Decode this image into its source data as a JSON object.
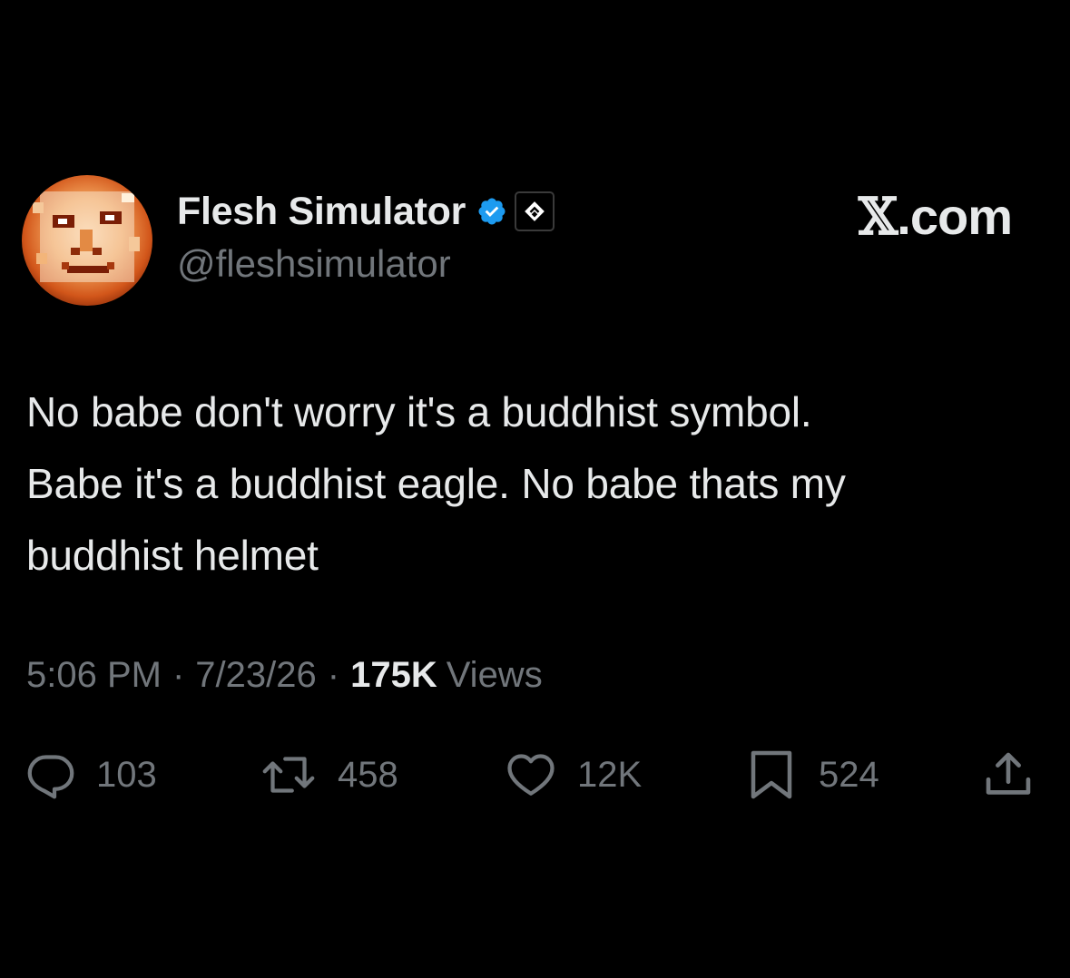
{
  "author": {
    "display_name": "Flesh Simulator",
    "handle": "@fleshsimulator",
    "verified": true,
    "verified_color": "#1d9bf0",
    "affiliate_badge_icon": "diamond-chevron-icon"
  },
  "brand": {
    "x_glyph": "𝕏",
    "suffix": ".com"
  },
  "tweet": {
    "lines": [
      "No babe don't worry it's a buddhist symbol.",
      "Babe it's a buddhist eagle. No babe thats my",
      "buddhist helmet"
    ]
  },
  "meta": {
    "time": "5:06 PM",
    "separator": "·",
    "date": "7/23/26",
    "views_count": "175K",
    "views_label": "Views"
  },
  "actions": {
    "replies": {
      "icon": "reply-bubble-icon",
      "count": "103"
    },
    "reposts": {
      "icon": "repost-icon",
      "count": "458"
    },
    "likes": {
      "icon": "heart-icon",
      "count": "12K"
    },
    "bookmarks": {
      "icon": "bookmark-icon",
      "count": "524"
    },
    "share": {
      "icon": "share-icon"
    }
  },
  "colors": {
    "background": "#000000",
    "primary_text": "#e7e9ea",
    "secondary_text": "#71767b",
    "verified_blue": "#1d9bf0"
  }
}
